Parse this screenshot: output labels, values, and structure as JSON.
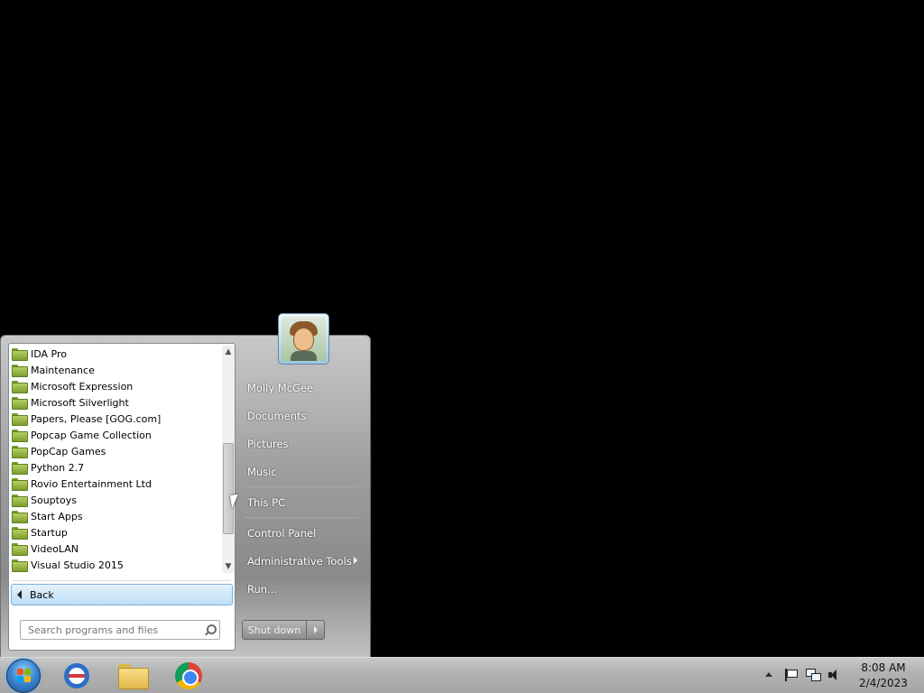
{
  "start_menu": {
    "programs": [
      {
        "label": "IDA Pro"
      },
      {
        "label": "Maintenance"
      },
      {
        "label": "Microsoft Expression"
      },
      {
        "label": "Microsoft Silverlight"
      },
      {
        "label": "Papers, Please [GOG.com]"
      },
      {
        "label": "Popcap Game Collection"
      },
      {
        "label": "PopCap Games"
      },
      {
        "label": "Python 2.7"
      },
      {
        "label": "Rovio Entertainment Ltd"
      },
      {
        "label": "Souptoys"
      },
      {
        "label": "Start Apps"
      },
      {
        "label": "Startup"
      },
      {
        "label": "VideoLAN"
      },
      {
        "label": "Visual Studio 2015"
      }
    ],
    "back_label": "Back",
    "search_placeholder": "Search programs and files",
    "right_items": {
      "user": "Molly McGee",
      "documents": "Documents",
      "pictures": "Pictures",
      "music": "Music",
      "this_pc": "This PC",
      "control_panel": "Control Panel",
      "admin_tools": "Administrative Tools",
      "run": "Run..."
    },
    "shutdown_label": "Shut down"
  },
  "taskbar": {
    "pinned": [
      "internet-explorer",
      "file-explorer",
      "chrome"
    ],
    "clock": {
      "time": "8:08 AM",
      "date": "2/4/2023"
    }
  }
}
